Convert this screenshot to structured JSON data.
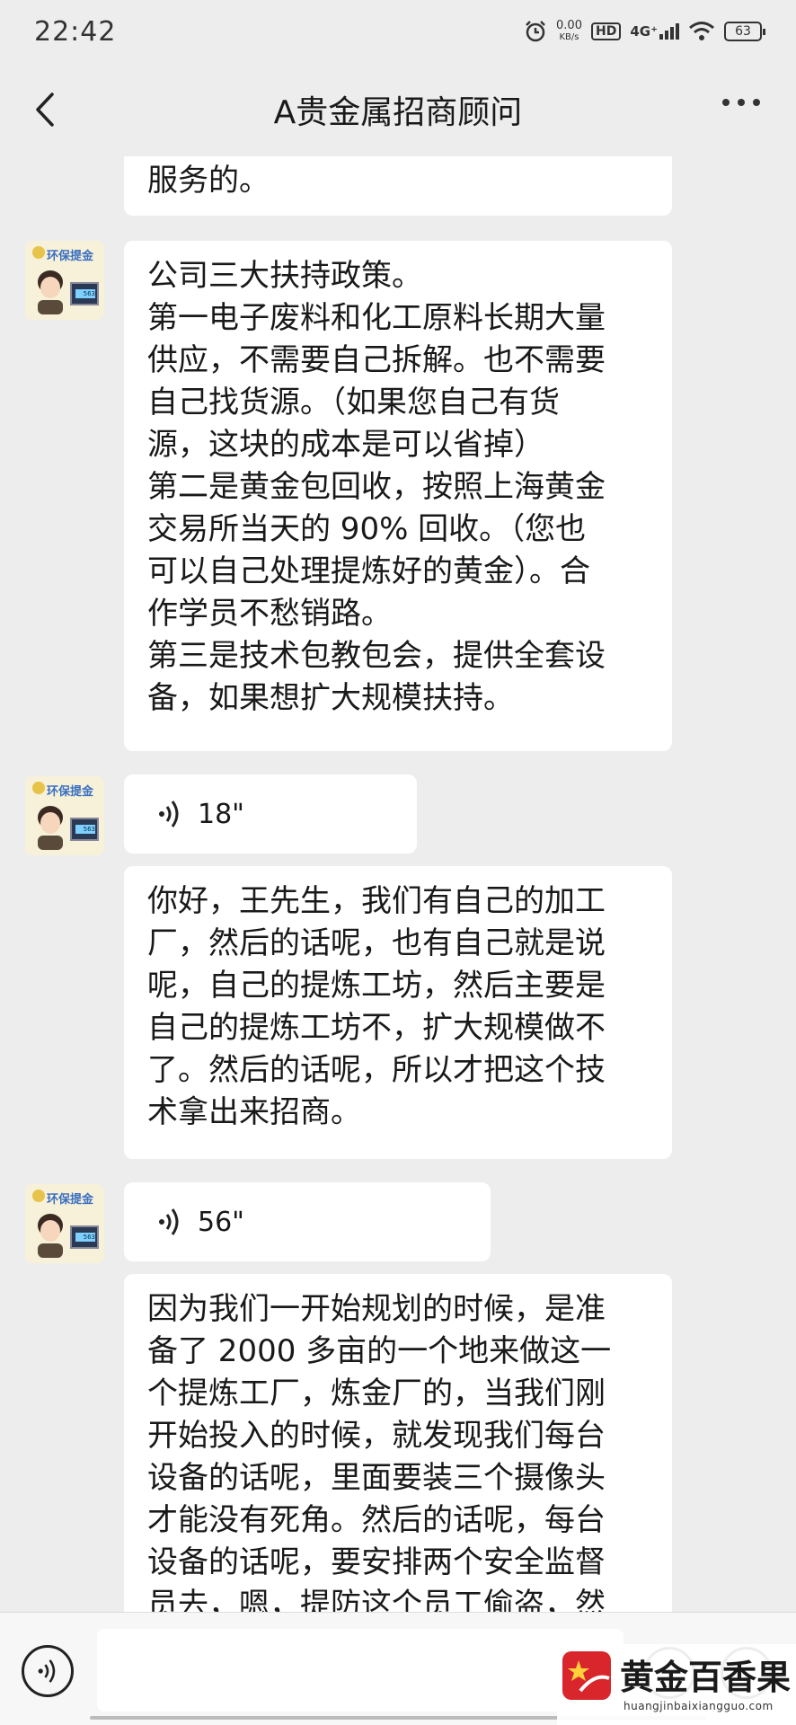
{
  "status_bar": {
    "time": "22:42",
    "net_speed_value": "0.00",
    "net_speed_unit": "KB/s",
    "hd": "HD",
    "network": "4G⁺",
    "battery": "63",
    "icons": [
      "alarm-icon",
      "wifi-icon",
      "signal-icon",
      "battery-icon"
    ]
  },
  "header": {
    "title": "A贵金属招商顾问",
    "back_icon": "chevron-left-icon",
    "more_icon": "more-dots-icon"
  },
  "messages": [
    {
      "type": "text",
      "partial": true,
      "lines": [
        "服务的。"
      ]
    },
    {
      "type": "text",
      "sender": "contact",
      "lines": [
        "公司三大扶持政策。",
        "第一电子废料和化工原料长期大量",
        "供应，不需要自己拆解。也不需要",
        "自己找货源。（如果您自己有货",
        "源，这块的成本是可以省掉）",
        "第二是黄金包回收，按照上海黄金",
        "交易所当天的 90% 回收。（您也",
        "可以自己处理提炼好的黄金）。合",
        "作学员不愁销路。",
        "第三是技术包教包会，提供全套设",
        "备，如果想扩大规模扶持。"
      ]
    },
    {
      "type": "voice",
      "sender": "contact",
      "duration": "18\""
    },
    {
      "type": "text",
      "sender": "contact",
      "lines": [
        "你好，王先生，我们有自己的加工",
        "厂，然后的话呢，也有自己就是说",
        "呢，自己的提炼工坊，然后主要是",
        "自己的提炼工坊不，扩大规模做不",
        "了。然后的话呢，所以才把这个技",
        "术拿出来招商。"
      ]
    },
    {
      "type": "voice",
      "sender": "contact",
      "duration": "56\""
    },
    {
      "type": "text",
      "sender": "contact",
      "lines": [
        "因为我们一开始规划的时候，是准",
        "备了 2000 多亩的一个地来做这一",
        "个提炼工厂，炼金厂的，当我们刚",
        "开始投入的时候，就发现我们每台",
        "设备的话呢，里面要装三个摄像头",
        "才能没有死角。然后的话呢，每台",
        "设备的话呢，要安排两个安全监督",
        "员去，嗯，提防这个员工偷盗，然"
      ]
    }
  ],
  "avatar": {
    "label": "环保提金",
    "scale_reading": "563"
  },
  "input_bar": {
    "voice_toggle_icon": "voice-mode-icon",
    "input_value": "",
    "emoji_icon": "emoji-icon",
    "plus_icon": "plus-icon"
  },
  "watermark": {
    "title": "黄金百香果",
    "url": "huangjinbaixiangguo.com"
  }
}
